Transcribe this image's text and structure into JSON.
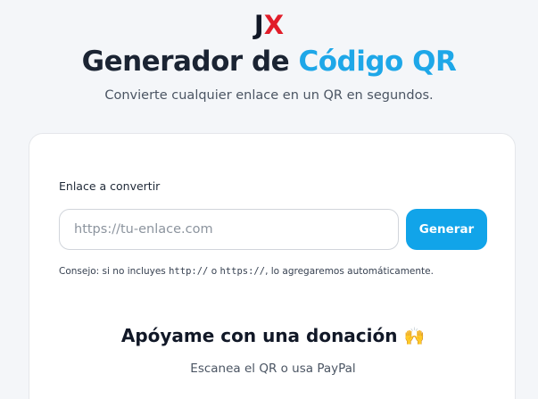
{
  "logo": {
    "letter_j": "J",
    "letter_x": "X"
  },
  "header": {
    "title_main": "Generador de ",
    "title_accent": "Código QR",
    "subtitle": "Convierte cualquier enlace en un QR en segundos."
  },
  "form": {
    "label": "Enlace a convertir",
    "placeholder": "https://tu-enlace.com",
    "value": "",
    "button_label": "Generar",
    "hint_prefix": "Consejo: si no incluyes ",
    "hint_code1": "http://",
    "hint_mid": " o ",
    "hint_code2": "https://",
    "hint_suffix": ", lo agregaremos automáticamente."
  },
  "donation": {
    "title": "Apóyame con una donación",
    "emoji": "🙌",
    "subtitle": "Escanea el QR o usa PayPal"
  },
  "colors": {
    "accent": "#1ea7e8",
    "button": "#11a4e9",
    "logo_x": "#e11d2a",
    "background": "#f4f6f9"
  }
}
